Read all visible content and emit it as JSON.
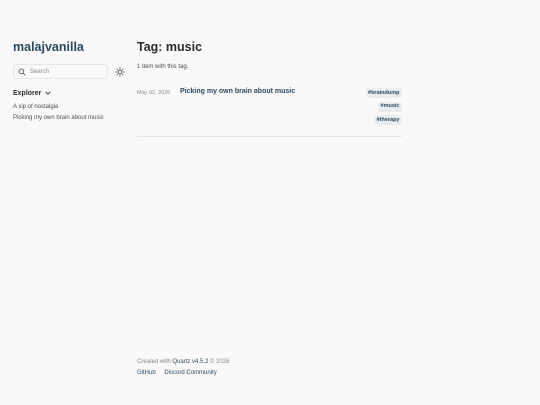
{
  "sidebar": {
    "site_title": "malajvanilla",
    "search_placeholder": "Search",
    "explorer_label": "Explorer",
    "explorer_items": [
      {
        "label": "A sip of nostalgia"
      },
      {
        "label": "Picking my own brain about music"
      }
    ]
  },
  "main": {
    "title": "Tag: music",
    "count_text": "1 item with this tag.",
    "entries": [
      {
        "date": "May 02, 2026",
        "title": "Picking my own brain about music",
        "tags": [
          "#braindump",
          "#music",
          "#therapy"
        ]
      }
    ]
  },
  "footer": {
    "created_prefix": "Created with ",
    "quartz_link": "Quartz v4.5.2",
    "created_suffix": " © 2026",
    "links": [
      "GitHub",
      "Discord Community"
    ]
  },
  "colors": {
    "accent": "#284b63",
    "background": "#faf8f8",
    "tag_bg": "#e8ecee"
  }
}
